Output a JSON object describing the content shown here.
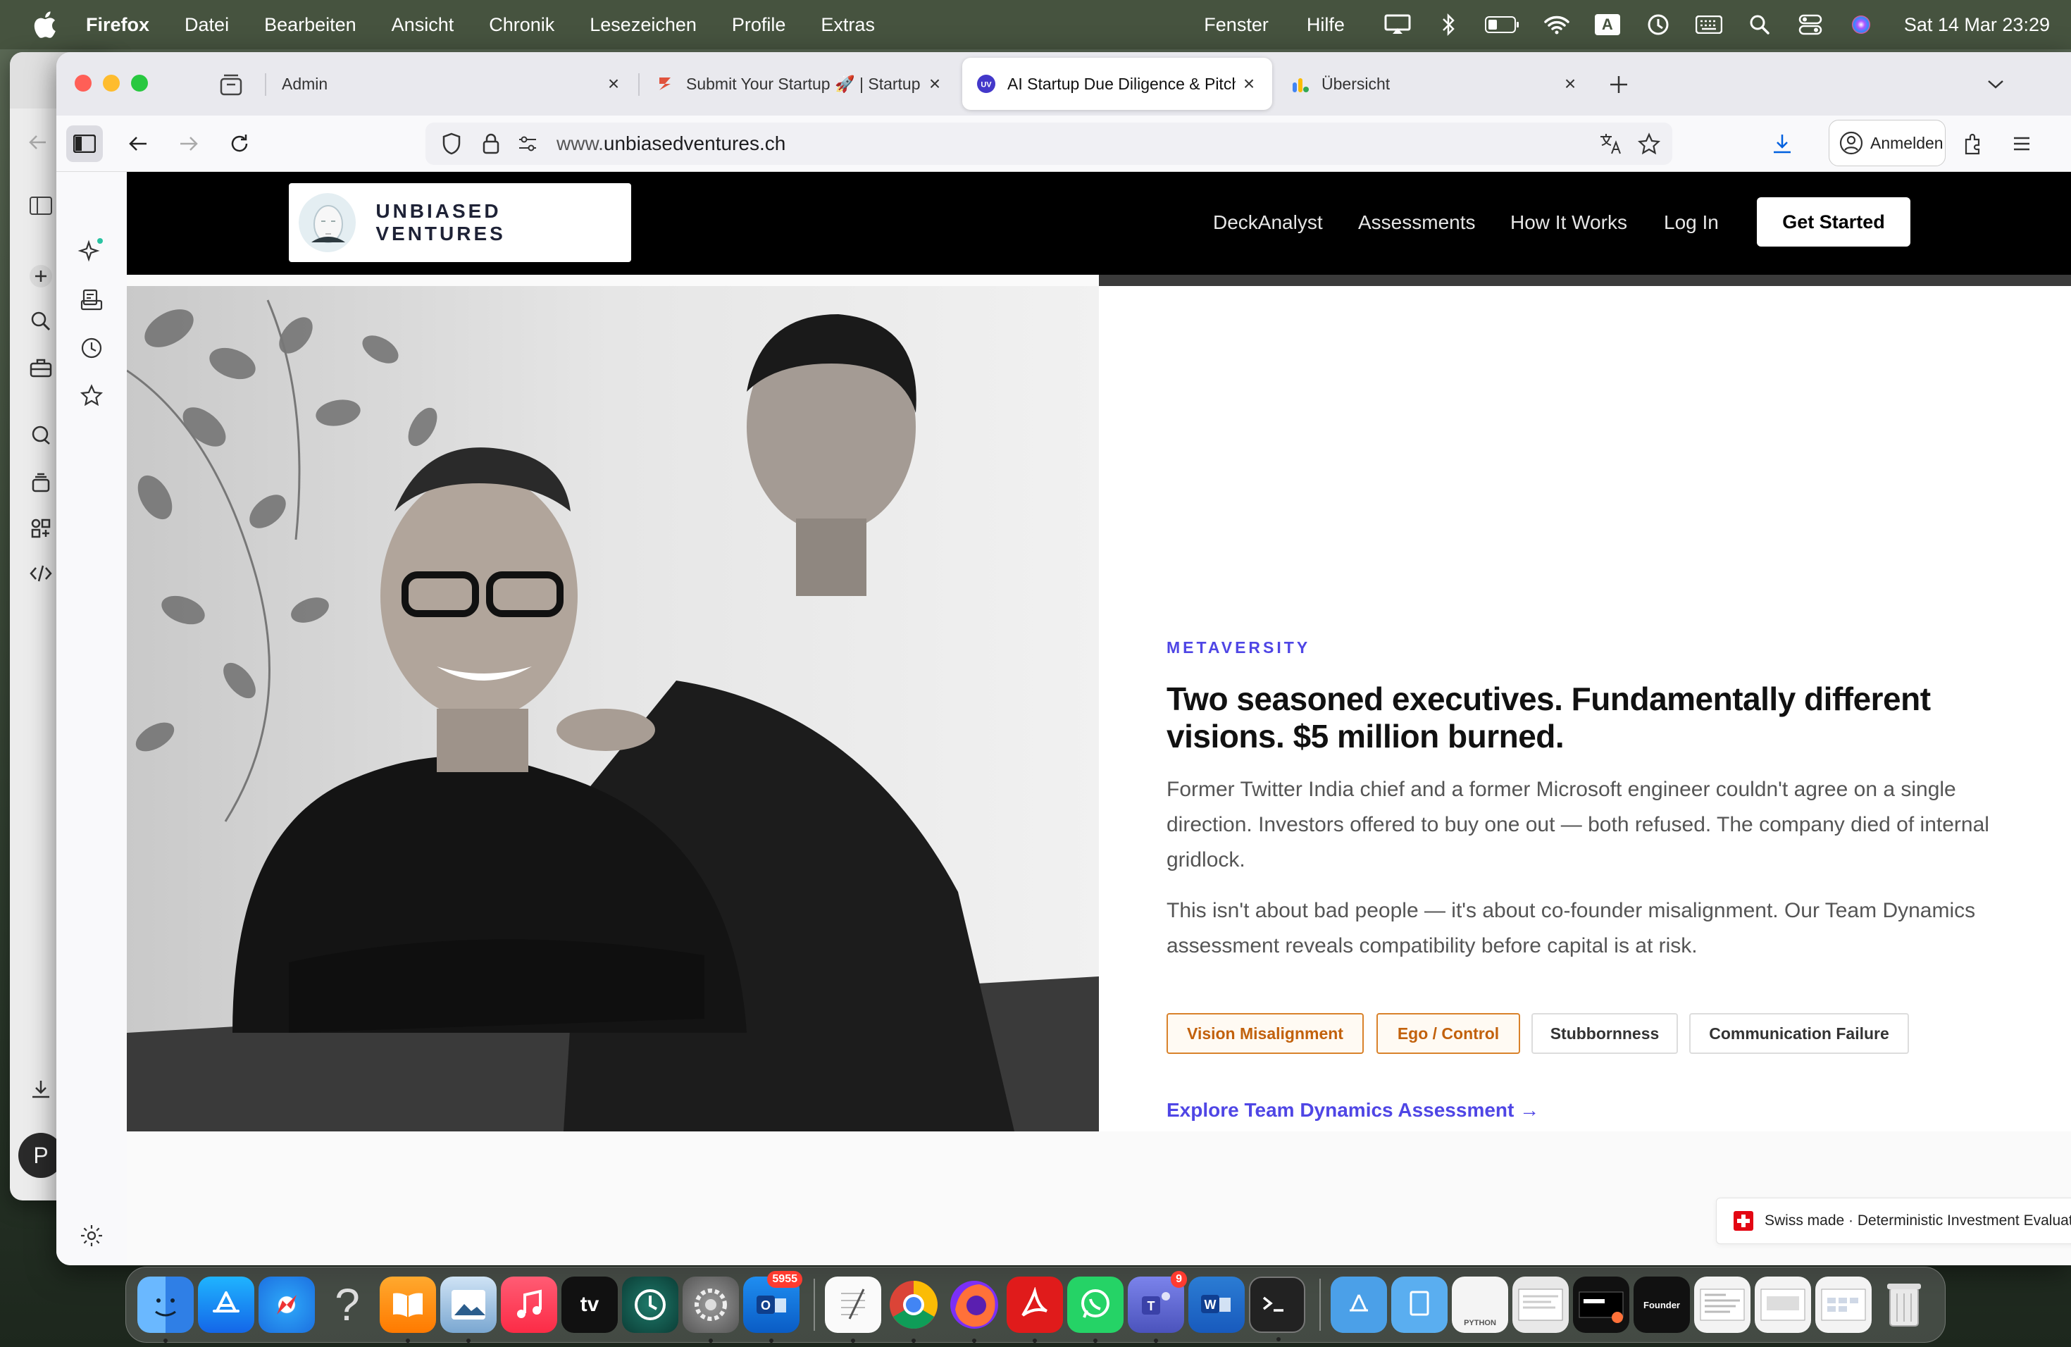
{
  "menubar": {
    "app": "Firefox",
    "items": [
      "Datei",
      "Bearbeiten",
      "Ansicht",
      "Chronik",
      "Lesezeichen",
      "Profile",
      "Extras"
    ],
    "right_items": [
      "Fenster",
      "Hilfe"
    ],
    "input_source": "A",
    "clock": "Sat 14 Mar  23:29"
  },
  "browser": {
    "tabs": [
      {
        "title": "Admin",
        "icon": "admin-icon",
        "active": false
      },
      {
        "title": "Submit Your Startup 🚀 | Startup",
        "icon": "startup-favicon",
        "active": false
      },
      {
        "title": "AI Startup Due Diligence & Pitch",
        "icon": "uv-favicon",
        "active": true
      },
      {
        "title": "Übersicht",
        "icon": "analytics-favicon",
        "active": false
      }
    ],
    "url_prefix": "www.",
    "url_domain": "unbiasedventures.ch",
    "signin_label": "Anmelden"
  },
  "site": {
    "logo_text": "UNBIASED VENTURES",
    "nav": [
      "DeckAnalyst",
      "Assessments",
      "How It Works",
      "Log In"
    ],
    "cta": "Get Started",
    "eyebrow": "METAVERSITY",
    "headline": "Two seasoned executives. Fundamentally different visions. $5 million burned.",
    "paragraph1": "Former Twitter India chief and a former Microsoft engineer couldn't agree on a single direction. Investors offered to buy one out — both refused. The company died of internal gridlock.",
    "paragraph2": "This isn't about bad people — it's about co-founder misalignment. Our Team Dynamics assessment reveals compatibility before capital is at risk.",
    "tags": [
      {
        "label": "Vision Misalignment",
        "highlight": true
      },
      {
        "label": "Ego / Control",
        "highlight": true
      },
      {
        "label": "Stubbornness",
        "highlight": false
      },
      {
        "label": "Communication Failure",
        "highlight": false
      }
    ],
    "explore_link": "Explore Team Dynamics Assessment →",
    "footer_badge": "Swiss made · Deterministic Investment Evaluation",
    "colors": {
      "accent": "#4f46e5",
      "warning": "#d9822b",
      "header": "#000000"
    }
  },
  "sidebar_avatar": "P",
  "dock": {
    "apps": [
      "Finder",
      "App Store",
      "Safari",
      "Tips",
      "Books",
      "Preview",
      "Music",
      "Apple TV",
      "Time Machine",
      "System Settings",
      "Outlook",
      "TextEdit",
      "Chrome",
      "Firefox",
      "Acrobat",
      "WhatsApp",
      "Teams",
      "Word",
      "Terminal"
    ],
    "outlook_badge": "5955",
    "teams_badge": "9",
    "tv_label": "tv",
    "tips_label": "?",
    "python_label": "PYTHON",
    "founder_label": "Founder"
  }
}
